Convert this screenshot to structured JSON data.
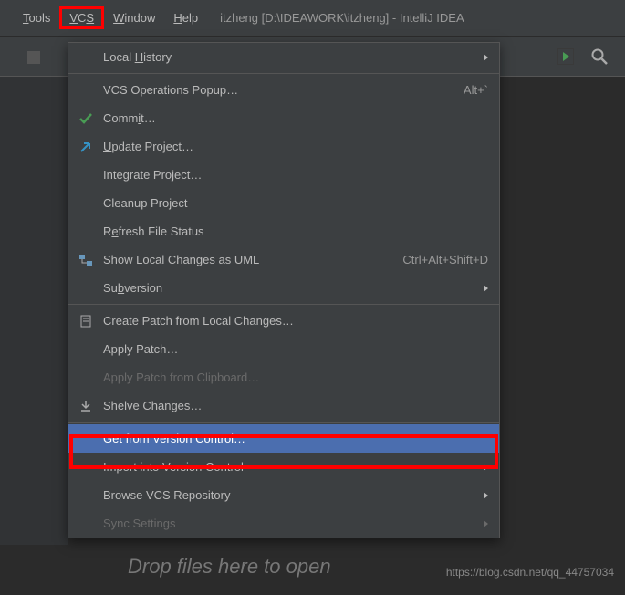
{
  "menubar": {
    "tools": "Tools",
    "vcs": "VCS",
    "window": "Window",
    "help": "Help",
    "title": "itzheng [D:\\IDEAWORK\\itzheng] - IntelliJ IDEA"
  },
  "dropdown": {
    "local_history": "Local History",
    "vcs_operations": "VCS Operations Popup…",
    "vcs_operations_shortcut": "Alt+`",
    "commit": "Commit…",
    "update_project": "Update Project…",
    "integrate_project": "Integrate Project…",
    "cleanup_project": "Cleanup Project",
    "refresh_file_status": "Refresh File Status",
    "show_local_changes_uml": "Show Local Changes as UML",
    "show_local_changes_uml_shortcut": "Ctrl+Alt+Shift+D",
    "subversion": "Subversion",
    "create_patch": "Create Patch from Local Changes…",
    "apply_patch": "Apply Patch…",
    "apply_patch_clipboard": "Apply Patch from Clipboard…",
    "shelve_changes": "Shelve Changes…",
    "get_from_vcs": "Get from Version Control…",
    "import_into_vcs": "Import into Version Control",
    "browse_vcs_repo": "Browse VCS Repository",
    "sync_settings": "Sync Settings"
  },
  "drop_text": "Drop files here to open",
  "watermark": "https://blog.csdn.net/qq_44757034"
}
